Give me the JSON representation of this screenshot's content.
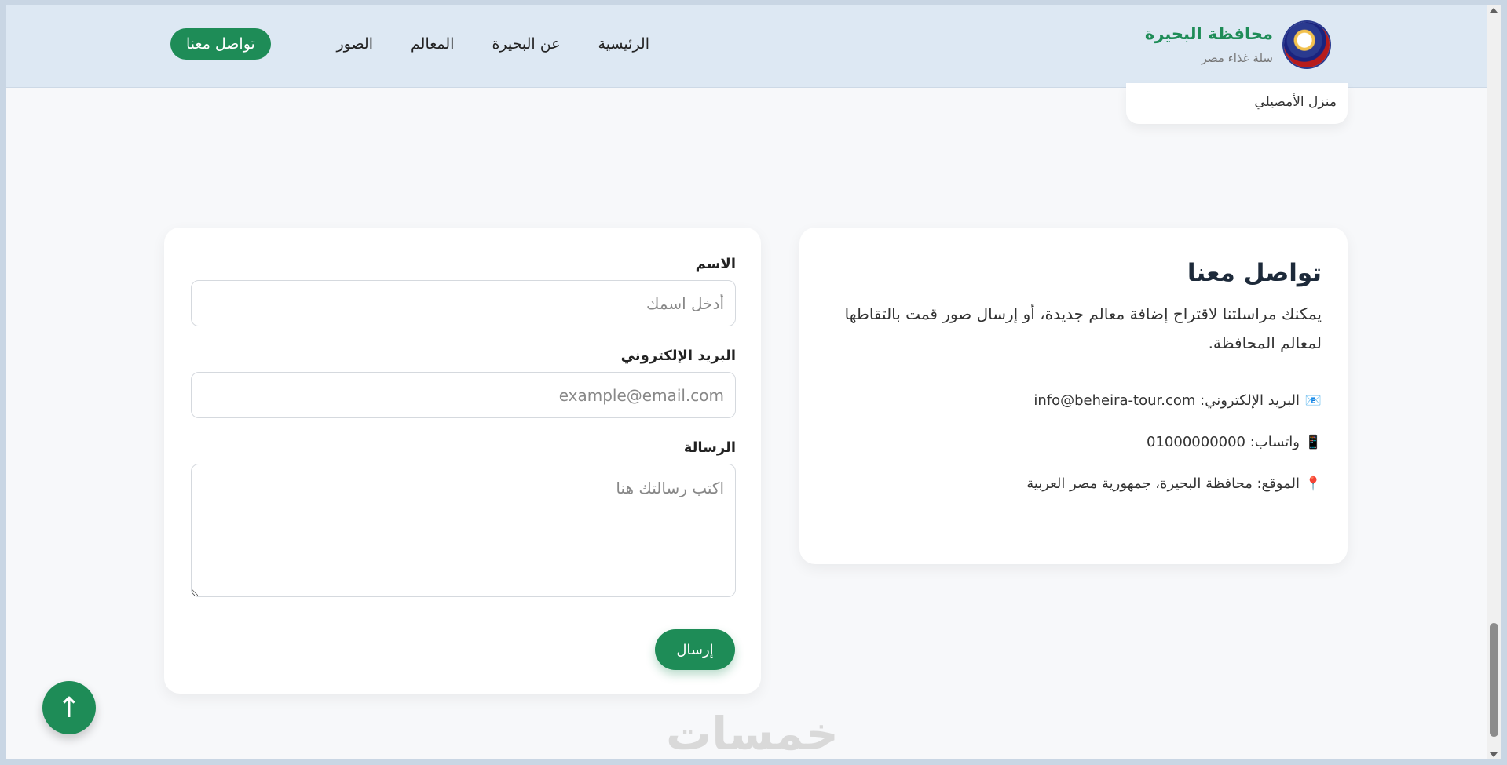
{
  "header": {
    "brand_title": "محافظة البحيرة",
    "brand_subtitle": "سلة غذاء مصر",
    "nav": [
      "الرئيسية",
      "عن البحيرة",
      "المعالم",
      "الصور"
    ],
    "cta_label": "تواصل معنا"
  },
  "remnant_card": {
    "text": "منزل الأمصيلي"
  },
  "info": {
    "title": "تواصل معنا",
    "description": "يمكنك مراسلتنا لاقتراح إضافة معالم جديدة، أو إرسال صور قمت بالتقاطها لمعالم المحافظة.",
    "items": [
      {
        "icon": "📧",
        "icon_name": "email-icon",
        "text": "البريد الإلكتروني: info@beheira-tour.com"
      },
      {
        "icon": "📱",
        "icon_name": "phone-icon",
        "text": "واتساب: 01000000000"
      },
      {
        "icon": "📍",
        "icon_name": "location-pin-icon",
        "text": "الموقع: محافظة البحيرة، جمهورية مصر العربية"
      }
    ]
  },
  "form": {
    "name_label": "الاسم",
    "name_placeholder": "أدخل اسمك",
    "email_label": "البريد الإلكتروني",
    "email_placeholder": "example@email.com",
    "message_label": "الرسالة",
    "message_placeholder": "اكتب رسالتك هنا",
    "submit_label": "إرسال"
  },
  "to_top": {
    "icon": "↑"
  },
  "watermark": "خمسات",
  "colors": {
    "accent": "#1e8c57",
    "header_bg": "#dde8f3",
    "page_bg": "#f7f8fa"
  }
}
